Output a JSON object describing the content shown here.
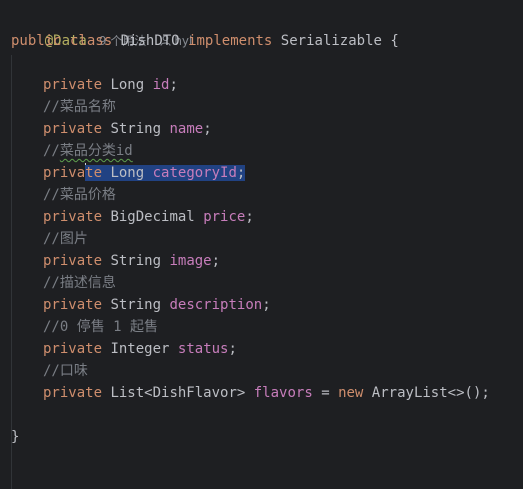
{
  "header": {
    "annotation": "@Data",
    "usages": "9 个用法",
    "author": "hyl",
    "author_icon": "user-icon"
  },
  "code": {
    "class_decl": {
      "kw1": "public",
      "kw2": "class",
      "name": "DishDTO",
      "kw3": "implements",
      "iface": "Serializable",
      "brace": "{"
    },
    "fields": [
      {
        "modifier": "private",
        "type": "Long",
        "name": "id"
      },
      {
        "comment": "//菜品名称"
      },
      {
        "modifier": "private",
        "type": "String",
        "name": "name"
      },
      {
        "comment_prefix": "//",
        "comment_typo": "菜品分类id"
      },
      {
        "modifier_a": "priva",
        "modifier_b": "te",
        "type": "Long",
        "name": "categoryId",
        "semicolon": ";"
      },
      {
        "comment": "//菜品价格"
      },
      {
        "modifier": "private",
        "type": "BigDecimal",
        "name": "price"
      },
      {
        "comment": "//图片"
      },
      {
        "modifier": "private",
        "type": "String",
        "name": "image"
      },
      {
        "comment": "//描述信息"
      },
      {
        "modifier": "private",
        "type": "String",
        "name": "description"
      },
      {
        "comment": "//0 停售 1 起售"
      },
      {
        "modifier": "private",
        "type": "Integer",
        "name": "status"
      },
      {
        "comment": "//口味"
      },
      {
        "modifier": "private",
        "type": "List<DishFlavor>",
        "name": "flavors",
        "assign": " = ",
        "kw_new": "new",
        "init": "ArrayList<>();"
      }
    ],
    "closing_brace": "}"
  },
  "colors": {
    "background": "#1e1f22",
    "keyword": "#cf8e6d",
    "field": "#c77dbb",
    "comment": "#7a7e85",
    "annotation": "#b3ae60",
    "selection": "#214283",
    "text": "#bcbec4"
  }
}
